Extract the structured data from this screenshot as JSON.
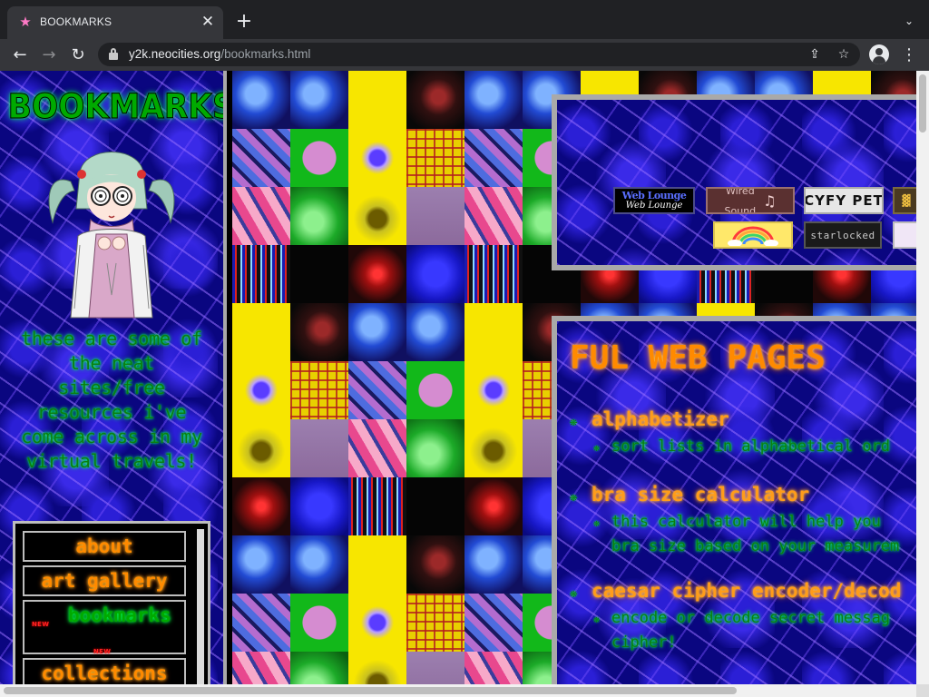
{
  "browser": {
    "tab_title": "BOOKMARKS",
    "new_tab_symbol": "+",
    "close_symbol": "✕",
    "url_host": "y2k.neocities.org",
    "url_path": "/bookmarks.html",
    "back_symbol": "←",
    "forward_symbol": "→",
    "reload_symbol": "↻",
    "share_symbol": "⇪",
    "bookmark_symbol": "☆",
    "menu_symbol": "⋮",
    "tab_menu_symbol": "⌄"
  },
  "sidebar": {
    "title": "BOOKMARKS",
    "description": "these are some of the neat sites/free resources i've come across in my virtual travels!",
    "nav": [
      {
        "label": "about"
      },
      {
        "label": "art gallery"
      },
      {
        "label": "bookmarks",
        "badge": "NEW"
      },
      {
        "label": "collections"
      }
    ]
  },
  "webring": {
    "badges": [
      {
        "name": "web-lounge",
        "line1": "Web Lounge",
        "line2": "Web Lounge"
      },
      {
        "name": "wired-sound",
        "line1": "Wired",
        "line2": "Sound",
        "icon": "music-note-icon"
      },
      {
        "name": "cyfy-pet",
        "text": "CYFY PET"
      },
      {
        "name": "rainbow",
        "icon": "rainbow-icon"
      },
      {
        "name": "starlocked",
        "text": "starlocked"
      }
    ]
  },
  "content": {
    "heading": "FUL WEB PAGES",
    "entries": [
      {
        "title": "alphabetizer",
        "desc": [
          "sort lists in alphabetical ord"
        ]
      },
      {
        "title": "bra size calculator",
        "desc": [
          "this calculator will help you",
          "bra size based on your measurem"
        ]
      },
      {
        "title": "caesar cipher encoder/decod",
        "desc": [
          "encode or decode secret messag",
          "cipher!"
        ]
      }
    ]
  },
  "colors": {
    "glow_green": "#00ff44",
    "glow_orange": "#ff8a00",
    "bg_purple": "#0a0680",
    "panel_border": "#a9a9a9"
  }
}
